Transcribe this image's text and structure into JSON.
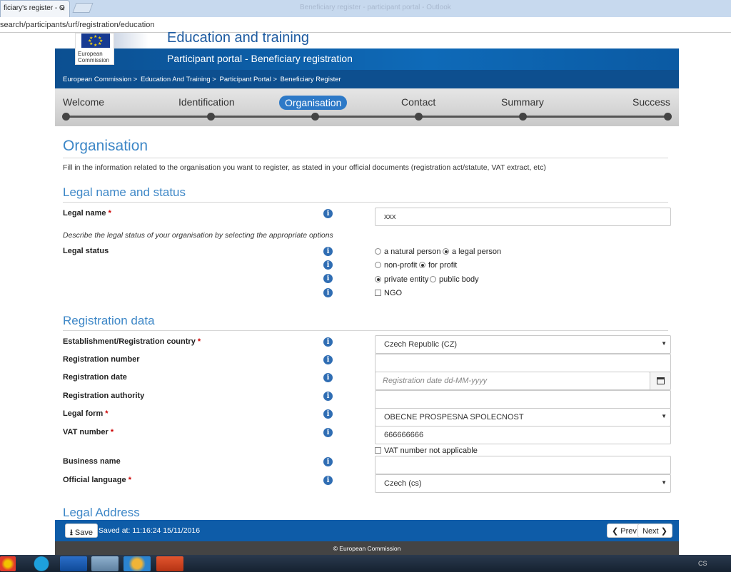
{
  "browser": {
    "tab_title": "ficiary's register - O",
    "tab_close": "×",
    "window_title": "Beneficiary register - participant portal - Outlook",
    "url": "search/participants/urf/registration/education"
  },
  "header": {
    "logo_text_1": "European",
    "logo_text_2": "Commission",
    "title": "Education and training",
    "subtitle": "Participant portal - Beneficiary registration",
    "breadcrumb": [
      "European Commission >",
      "Education And Training >",
      "Participant Portal >",
      "Beneficiary Register"
    ]
  },
  "steps": [
    "Welcome",
    "Identification",
    "Organisation",
    "Contact",
    "Summary",
    "Success"
  ],
  "active_step": "Organisation",
  "page": {
    "title": "Organisation",
    "intro": "Fill in the information related to the organisation you want to register, as stated in your official documents (registration act/statute, VAT extract, etc)"
  },
  "legal_section": {
    "heading": "Legal name and status",
    "legal_name_label": "Legal name",
    "required_mark": "*",
    "legal_name_value": "xxx",
    "hint": "Describe the legal status of your organisation by selecting the appropriate options",
    "legal_status_label": "Legal status",
    "options": {
      "natural_person": "a natural person",
      "legal_person": "a legal person",
      "non_profit": "non-profit",
      "for_profit": "for profit",
      "private_entity": "private entity",
      "public_body": "public body",
      "ngo": "NGO"
    }
  },
  "registration_section": {
    "heading": "Registration data",
    "country_label": "Establishment/Registration country",
    "country_value": "Czech Republic (CZ)",
    "number_label": "Registration number",
    "date_label": "Registration date",
    "date_placeholder": "Registration date dd-MM-yyyy",
    "authority_label": "Registration authority",
    "legal_form_label": "Legal form",
    "legal_form_value": "OBECNE PROSPESNA SPOLECNOST",
    "vat_label": "VAT number",
    "vat_value": "666666666",
    "vat_na_label": "VAT number not applicable",
    "business_label": "Business name",
    "language_label": "Official language",
    "language_value": "Czech (cs)",
    "info_glyph": "i",
    "select_arrow": "▼"
  },
  "address_section": {
    "heading": "Legal Address"
  },
  "footer": {
    "save_label": "Save",
    "saved_text": "Saved at: 11:16:24 15/11/2016",
    "prev_label": "Prev",
    "next_label": "Next",
    "copyright": "© European Commission"
  },
  "taskbar": {
    "language": "CS"
  }
}
